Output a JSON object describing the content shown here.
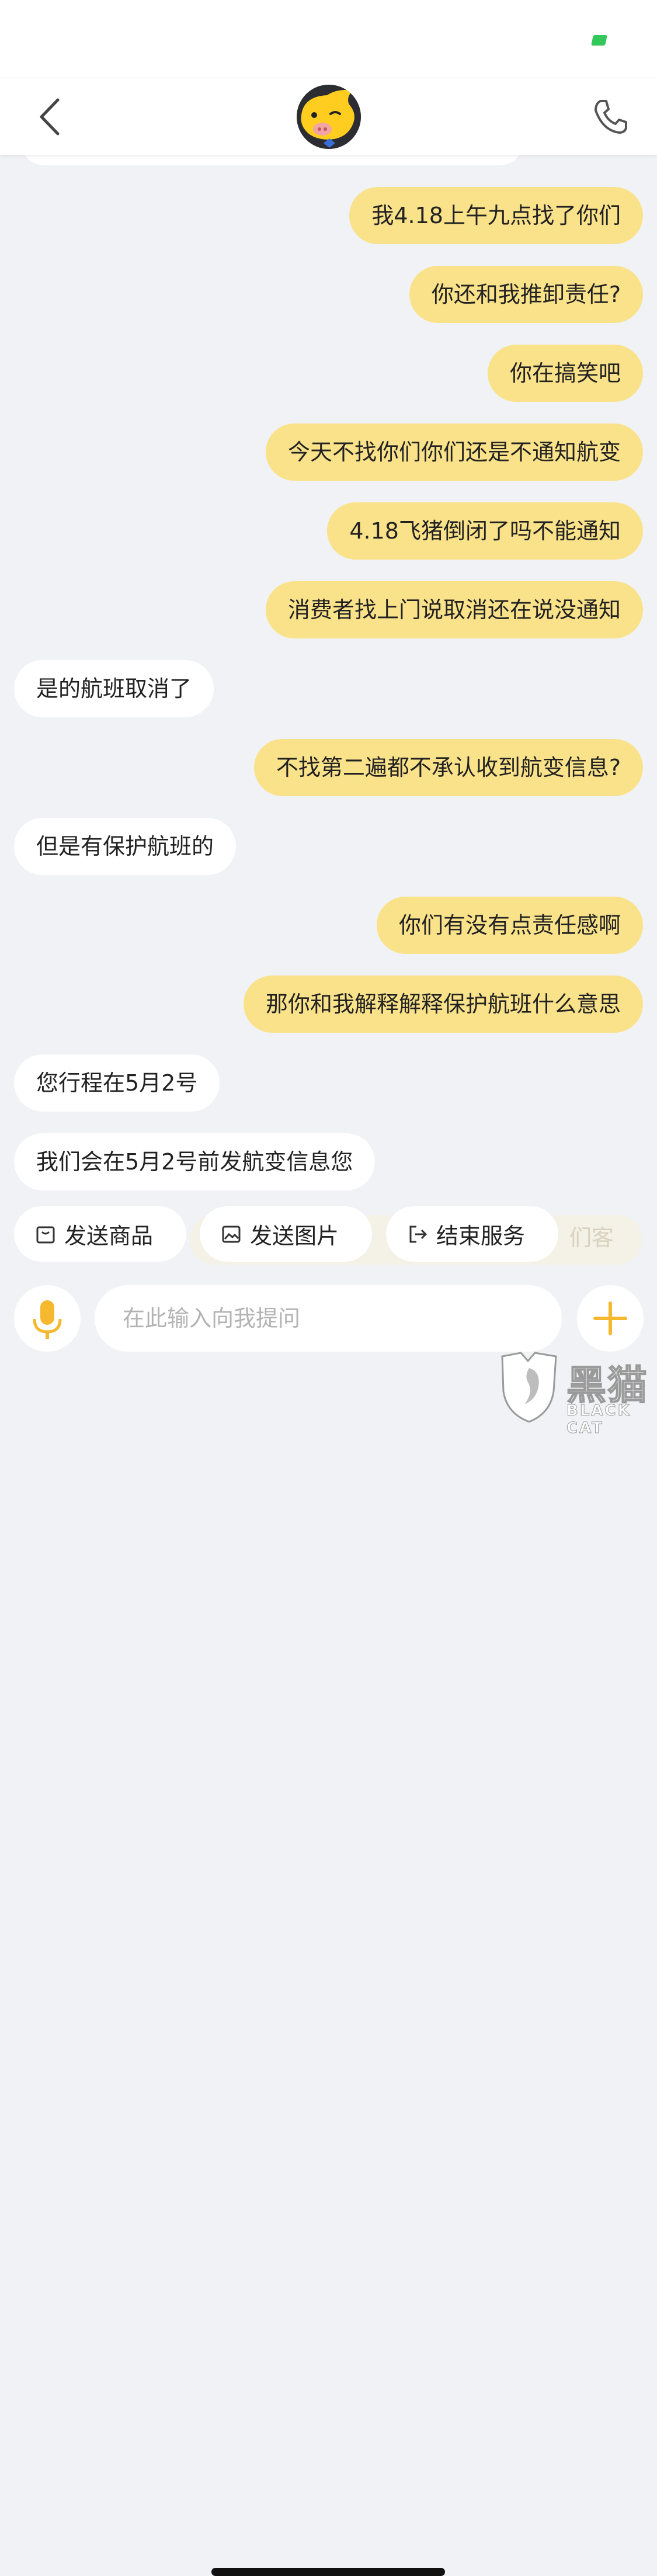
{
  "messages": [
    {
      "side": "me",
      "text": "我4.18上午九点找了你们"
    },
    {
      "side": "me",
      "text": "你还和我推卸责任?"
    },
    {
      "side": "me",
      "text": "你在搞笑吧"
    },
    {
      "side": "me",
      "text": "今天不找你们你们还是不通知航变"
    },
    {
      "side": "me",
      "text": "4.18飞猪倒闭了吗不能通知"
    },
    {
      "side": "me",
      "text": "消费者找上门说取消还在说没通知"
    },
    {
      "side": "them",
      "text": "是的航班取消了"
    },
    {
      "side": "me",
      "text": "不找第二遍都不承认收到航变信息?"
    },
    {
      "side": "them",
      "text": "但是有保护航班的"
    },
    {
      "side": "me",
      "text": "你们有没有点责任感啊"
    },
    {
      "side": "me",
      "text": "那你和我解释解释保护航班什么意思"
    },
    {
      "side": "them",
      "text": "您行程在5月2号"
    },
    {
      "side": "them",
      "text": "我们会在5月2号前发航变信息您"
    }
  ],
  "quick_actions": [
    {
      "label": "发送商品",
      "icon": "product-icon"
    },
    {
      "label": "发送图片",
      "icon": "image-icon"
    },
    {
      "label": "结束服务",
      "icon": "exit-icon"
    }
  ],
  "ghost_text": "们客",
  "input": {
    "placeholder": "在此输入向我提问"
  },
  "header": {
    "avatar_icon": "fliggy-mascot-icon",
    "back_icon": "chevron-left-icon",
    "call_icon": "phone-icon"
  },
  "watermark": {
    "cn": "黑猫",
    "en": "BLACK CAT"
  },
  "colors": {
    "my_bubble": "#fae28a",
    "their_bubble": "#ffffff",
    "background": "#f0f2f5",
    "accent": "#f5b82e"
  }
}
